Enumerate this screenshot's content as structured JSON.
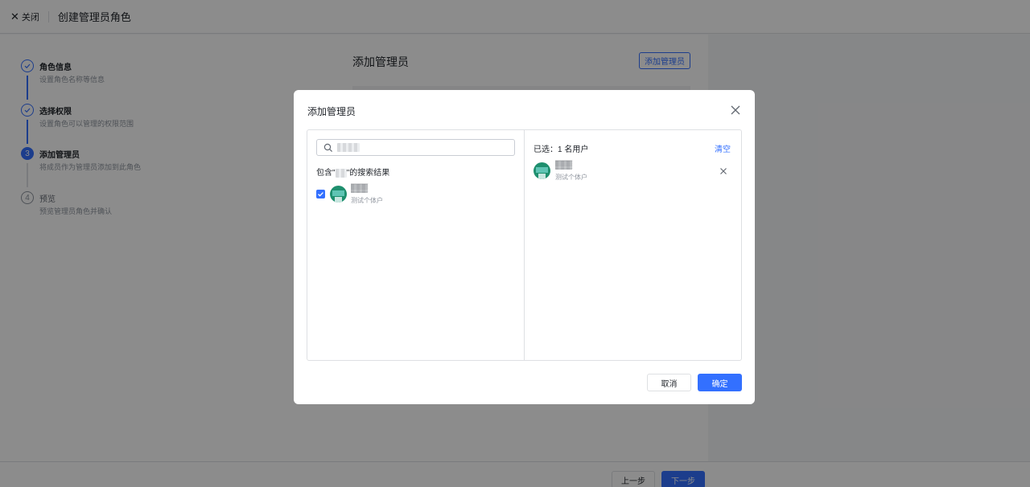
{
  "header": {
    "close_label": "关闭",
    "title": "创建管理员角色"
  },
  "steps": [
    {
      "title": "角色信息",
      "desc": "设置角色名称等信息",
      "status": "done",
      "number": "1"
    },
    {
      "title": "选择权限",
      "desc": "设置角色可以管理的权限范围",
      "status": "done",
      "number": "2"
    },
    {
      "title": "添加管理员",
      "desc": "将成员作为管理员添加到此角色",
      "status": "active",
      "number": "3"
    },
    {
      "title": "预览",
      "desc": "预览管理员角色并确认",
      "status": "pending",
      "number": "4"
    }
  ],
  "main": {
    "title": "添加管理员",
    "add_button": "添加管理员"
  },
  "footer": {
    "prev": "上一步",
    "next": "下一步"
  },
  "modal": {
    "title": "添加管理员",
    "search": {
      "value": "▒▒▒▒"
    },
    "result_label_prefix": "包含\"",
    "result_label_query": "▒▒",
    "result_label_suffix": "\"的搜索结果",
    "results": [
      {
        "name": "▒▒▒",
        "subtitle": "测试个体户",
        "checked": true
      }
    ],
    "selected_count": "已选：1 名用户",
    "clear": "清空",
    "selected": [
      {
        "name": "▒▒▒",
        "subtitle": "测试个体户"
      }
    ],
    "cancel": "取消",
    "confirm": "确定"
  },
  "colors": {
    "primary": "#3370ff",
    "overlay": "rgba(0,0,0,0.45)",
    "avatar": "#1e8f6e"
  }
}
